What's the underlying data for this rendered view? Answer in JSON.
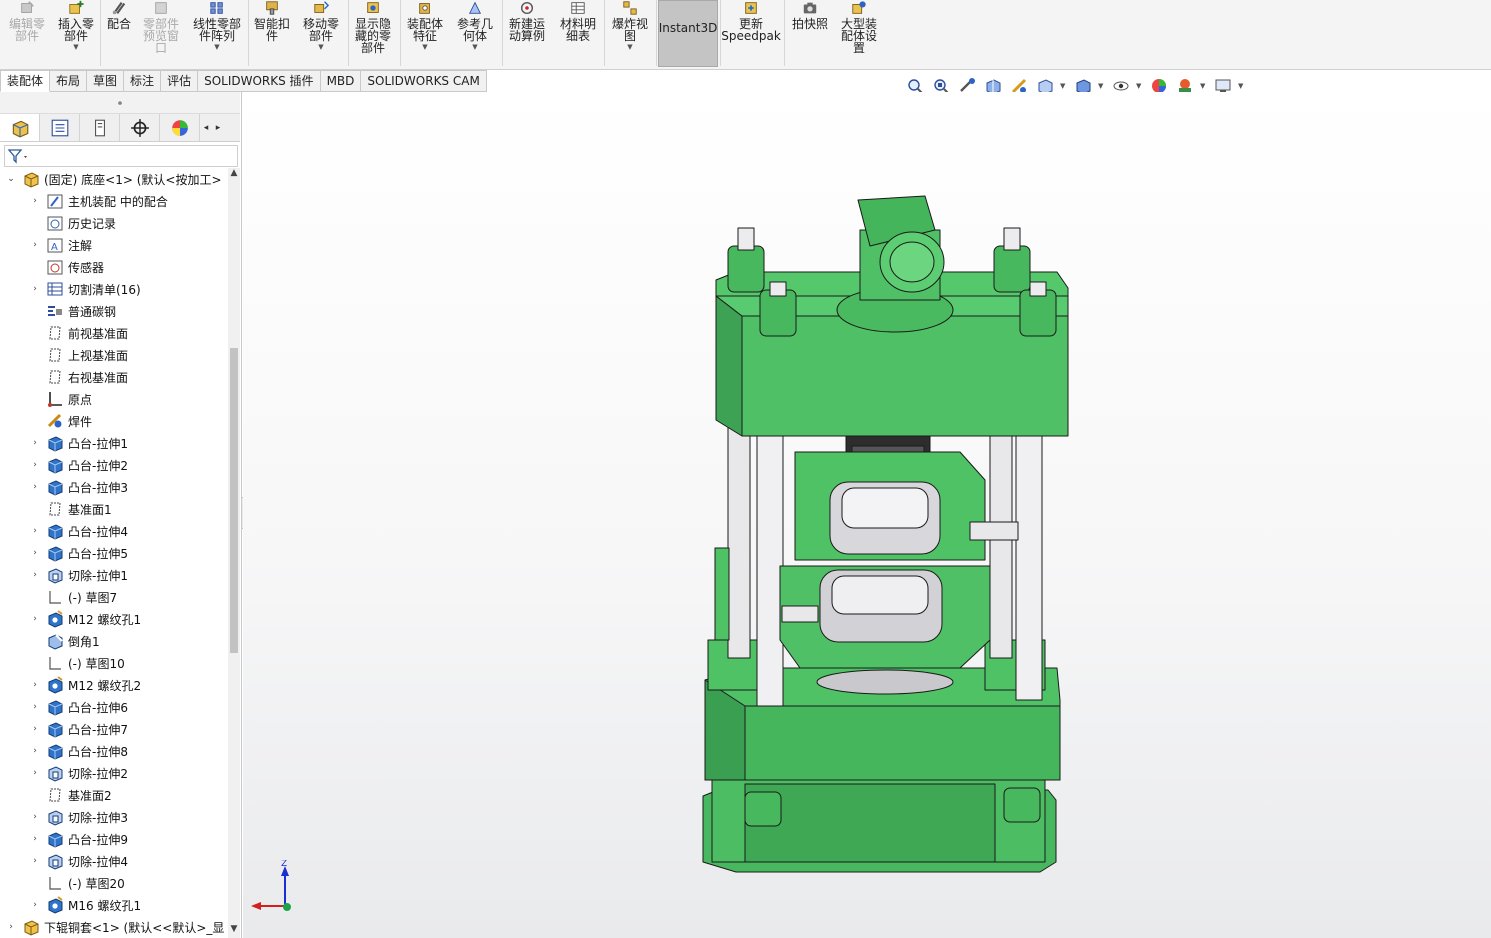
{
  "ribbon": {
    "buttons": [
      {
        "label": "编辑零\n部件",
        "icon": "edit-component-icon",
        "disabled": true
      },
      {
        "label": "插入零\n部件",
        "icon": "insert-component-icon",
        "dropdown": true
      },
      {
        "label": "配合",
        "icon": "mate-icon"
      },
      {
        "label": "零部件\n预览窗\n口",
        "icon": "component-preview-icon",
        "disabled": true
      },
      {
        "label": "线性零部\n件阵列",
        "icon": "linear-pattern-icon",
        "dropdown": true
      },
      {
        "label": "智能扣\n件",
        "icon": "smart-fastener-icon"
      },
      {
        "label": "移动零\n部件",
        "icon": "move-component-icon",
        "dropdown": true
      },
      {
        "label": "显示隐\n藏的零\n部件",
        "icon": "show-hidden-icon"
      },
      {
        "label": "装配体\n特征",
        "icon": "assembly-feature-icon",
        "dropdown": true
      },
      {
        "label": "参考几\n何体",
        "icon": "reference-geometry-icon",
        "dropdown": true
      },
      {
        "label": "新建运\n动算例",
        "icon": "motion-study-icon"
      },
      {
        "label": "材料明\n细表",
        "icon": "bom-icon"
      },
      {
        "label": "爆炸视\n图",
        "icon": "exploded-view-icon",
        "dropdown": true
      },
      {
        "label": "Instant3D",
        "icon": "",
        "active": true
      },
      {
        "label": "更新\nSpeedpak",
        "icon": "speedpak-icon"
      },
      {
        "label": "拍快照",
        "icon": "snapshot-icon"
      },
      {
        "label": "大型装\n配体设\n置",
        "icon": "large-assembly-icon"
      }
    ]
  },
  "tabs": [
    "装配体",
    "布局",
    "草图",
    "标注",
    "评估",
    "SOLIDWORKS 插件",
    "MBD",
    "SOLIDWORKS CAM"
  ],
  "active_tab": "装配体",
  "viewbar": {
    "icons": [
      "zoom-to-fit-icon",
      "zoom-to-area-icon",
      "previous-view-icon",
      "section-view-icon",
      "dynamic-annotation-icon",
      "view-orientation-icon",
      "display-style-icon",
      "hide-show-items-icon",
      "edit-appearance-icon",
      "apply-scene-icon",
      "view-settings-icon"
    ]
  },
  "panel": {
    "tabs": [
      "feature-manager-icon",
      "property-manager-icon",
      "configuration-manager-icon",
      "dimxpert-icon",
      "display-manager-icon"
    ],
    "tree": [
      {
        "label": "(固定) 底座<1> (默认<按加工>",
        "icon": "part-icon",
        "expander": "collapse",
        "level": 0
      },
      {
        "label": "主机装配 中的配合",
        "icon": "mates-folder-icon",
        "expander": "expand",
        "level": 1
      },
      {
        "label": "历史记录",
        "icon": "history-icon",
        "expander": "",
        "level": 1
      },
      {
        "label": "注解",
        "icon": "annotations-icon",
        "expander": "expand",
        "level": 1
      },
      {
        "label": "传感器",
        "icon": "sensor-icon",
        "expander": "",
        "level": 1
      },
      {
        "label": "切割清单(16)",
        "icon": "cut-list-icon",
        "expander": "expand",
        "level": 1
      },
      {
        "label": "普通碳钢",
        "icon": "material-icon",
        "expander": "",
        "level": 1
      },
      {
        "label": "前视基准面",
        "icon": "plane-icon",
        "expander": "",
        "level": 1
      },
      {
        "label": "上视基准面",
        "icon": "plane-icon",
        "expander": "",
        "level": 1
      },
      {
        "label": "右视基准面",
        "icon": "plane-icon",
        "expander": "",
        "level": 1
      },
      {
        "label": "原点",
        "icon": "origin-icon",
        "expander": "",
        "level": 1
      },
      {
        "label": "焊件",
        "icon": "weldment-icon",
        "expander": "",
        "level": 1
      },
      {
        "label": "凸台-拉伸1",
        "icon": "boss-extrude-icon",
        "expander": "expand",
        "level": 1
      },
      {
        "label": "凸台-拉伸2",
        "icon": "boss-extrude-icon",
        "expander": "expand",
        "level": 1
      },
      {
        "label": "凸台-拉伸3",
        "icon": "boss-extrude-icon",
        "expander": "expand",
        "level": 1
      },
      {
        "label": "基准面1",
        "icon": "plane-icon",
        "expander": "",
        "level": 1
      },
      {
        "label": "凸台-拉伸4",
        "icon": "boss-extrude-icon",
        "expander": "expand",
        "level": 1
      },
      {
        "label": "凸台-拉伸5",
        "icon": "boss-extrude-icon",
        "expander": "expand",
        "level": 1
      },
      {
        "label": "切除-拉伸1",
        "icon": "cut-extrude-icon",
        "expander": "expand",
        "level": 1
      },
      {
        "label": "(-) 草图7",
        "icon": "sketch-icon",
        "expander": "",
        "level": 1
      },
      {
        "label": "M12 螺纹孔1",
        "icon": "hole-wizard-icon",
        "expander": "expand",
        "level": 1
      },
      {
        "label": "倒角1",
        "icon": "chamfer-icon",
        "expander": "",
        "level": 1
      },
      {
        "label": "(-) 草图10",
        "icon": "sketch-icon",
        "expander": "",
        "level": 1
      },
      {
        "label": "M12 螺纹孔2",
        "icon": "hole-wizard-icon",
        "expander": "expand",
        "level": 1
      },
      {
        "label": "凸台-拉伸6",
        "icon": "boss-extrude-icon",
        "expander": "expand",
        "level": 1
      },
      {
        "label": "凸台-拉伸7",
        "icon": "boss-extrude-icon",
        "expander": "expand",
        "level": 1
      },
      {
        "label": "凸台-拉伸8",
        "icon": "boss-extrude-icon",
        "expander": "expand",
        "level": 1
      },
      {
        "label": "切除-拉伸2",
        "icon": "cut-extrude-icon",
        "expander": "expand",
        "level": 1
      },
      {
        "label": "基准面2",
        "icon": "plane-icon",
        "expander": "",
        "level": 1
      },
      {
        "label": "切除-拉伸3",
        "icon": "cut-extrude-icon",
        "expander": "expand",
        "level": 1
      },
      {
        "label": "凸台-拉伸9",
        "icon": "boss-extrude-icon",
        "expander": "expand",
        "level": 1
      },
      {
        "label": "切除-拉伸4",
        "icon": "cut-extrude-icon",
        "expander": "expand",
        "level": 1
      },
      {
        "label": "(-) 草图20",
        "icon": "sketch-icon",
        "expander": "",
        "level": 1
      },
      {
        "label": "M16 螺纹孔1",
        "icon": "hole-wizard-icon",
        "expander": "expand",
        "level": 1
      },
      {
        "label": "下辊铜套<1> (默认<<默认>_显",
        "icon": "part-icon",
        "expander": "expand",
        "level": 0
      }
    ]
  },
  "triad": {
    "z": "Z"
  },
  "colors": {
    "model_green": "#4fbf66",
    "model_green_dark": "#37a04e",
    "viewport_bg": "#ffffff",
    "active_ribbon": "#c4c4c4"
  }
}
